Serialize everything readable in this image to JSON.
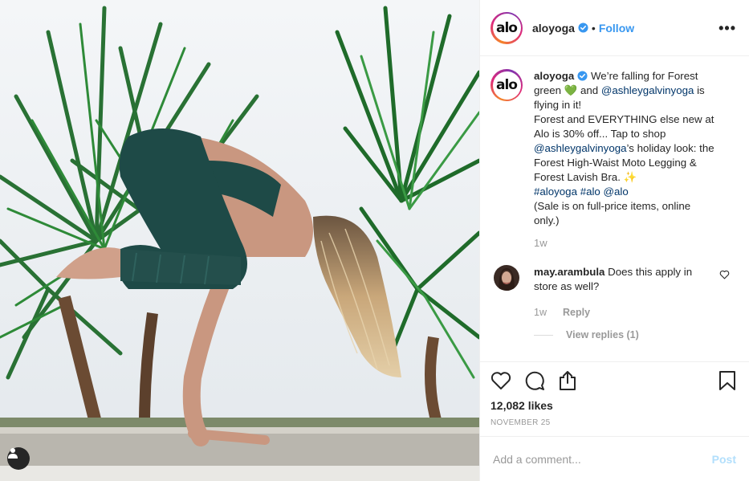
{
  "post": {
    "username": "aloyoga",
    "avatar_text": "alo",
    "follow_label": "Follow",
    "separator": "•",
    "more_label": "•••"
  },
  "caption": {
    "username": "aloyoga",
    "text_1": "We’re falling for Forest green",
    "emoji_heart": "💚",
    "text_2": "and",
    "mention_1": "@ashleygalvinyoga",
    "text_3": "is flying in it!",
    "text_4": "Forest and EVERYTHING else new at Alo is 30% off... Tap to shop",
    "mention_2": "@ashleygalvinyoga",
    "text_5": "’s holiday look: the Forest High-Waist Moto Legging & Forest Lavish Bra.",
    "emoji_sparkle": "✨",
    "hashtag": "#aloyoga",
    "hashtag_2": "#alo",
    "mention_3": "@alo",
    "text_6": "(Sale is on full-price items, online only.)",
    "age": "1w"
  },
  "comment": {
    "username": "may.arambula",
    "text": "Does this apply in store as well?",
    "age": "1w",
    "reply_label": "Reply",
    "view_replies": "View replies (1)"
  },
  "stats": {
    "likes": "12,082 likes",
    "date": "NOVEMBER 25"
  },
  "composer": {
    "placeholder": "Add a comment...",
    "post_label": "Post"
  },
  "colors": {
    "link_blue": "#3897f0",
    "mention_blue": "#003569",
    "legging_green": "#1e4a47"
  },
  "icons": [
    "verified-badge-icon",
    "more-options-icon",
    "heart-icon",
    "comment-icon",
    "share-icon",
    "bookmark-icon",
    "user-tag-icon",
    "small-heart-icon"
  ]
}
